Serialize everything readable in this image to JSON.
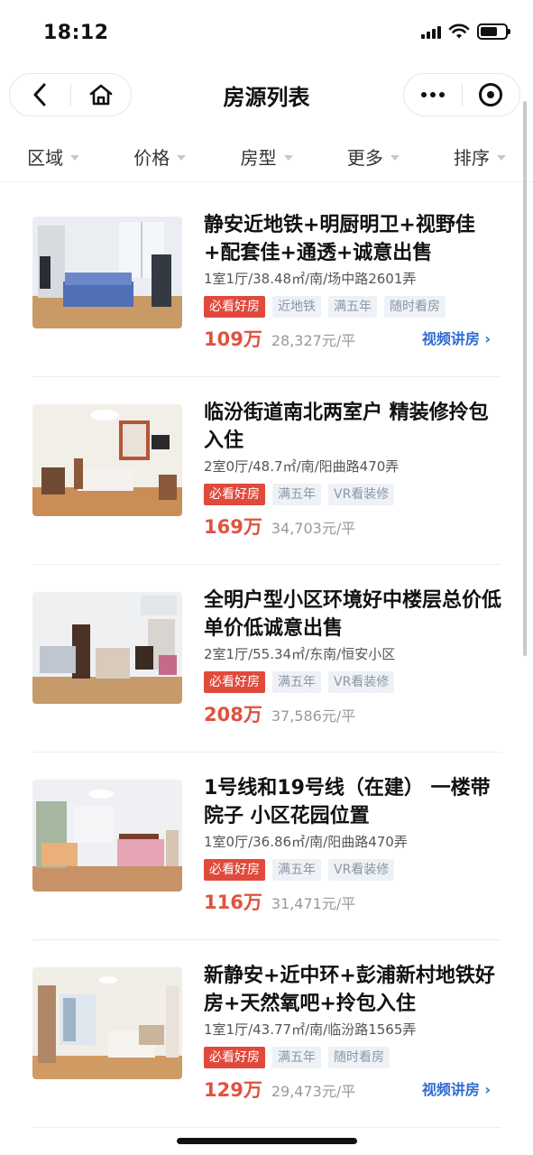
{
  "status": {
    "time": "18:12",
    "icons": [
      "signal-icon",
      "wifi-icon",
      "battery-icon"
    ]
  },
  "nav": {
    "title": "房源列表",
    "back_icon": "back-chevron-icon",
    "home_icon": "home-icon",
    "more_icon": "more-dots-icon",
    "close_icon": "target-icon"
  },
  "filters": [
    {
      "label": "区域"
    },
    {
      "label": "价格"
    },
    {
      "label": "房型"
    },
    {
      "label": "更多"
    },
    {
      "label": "排序"
    }
  ],
  "listings": [
    {
      "title": "静安近地铁+明厨明卫+视野佳+配套佳+通透+诚意出售",
      "meta": "1室1厅/38.48㎡/南/场中路2601弄",
      "tags": [
        "必看好房",
        "近地铁",
        "满五年",
        "随时看房"
      ],
      "price": "109万",
      "unit_price": "28,327元/平",
      "video": "视频讲房 ›"
    },
    {
      "title": "临汾街道南北两室户 精装修拎包入住",
      "meta": "2室0厅/48.7㎡/南/阳曲路470弄",
      "tags": [
        "必看好房",
        "满五年",
        "VR看装修"
      ],
      "price": "169万",
      "unit_price": "34,703元/平",
      "video": ""
    },
    {
      "title": "全明户型小区环境好中楼层总价低单价低诚意出售",
      "meta": "2室1厅/55.34㎡/东南/恒安小区",
      "tags": [
        "必看好房",
        "满五年",
        "VR看装修"
      ],
      "price": "208万",
      "unit_price": "37,586元/平",
      "video": ""
    },
    {
      "title": "1号线和19号线（在建） 一楼带院子 小区花园位置",
      "meta": "1室0厅/36.86㎡/南/阳曲路470弄",
      "tags": [
        "必看好房",
        "满五年",
        "VR看装修"
      ],
      "price": "116万",
      "unit_price": "31,471元/平",
      "video": ""
    },
    {
      "title": "新静安+近中环+彭浦新村地铁好房+天然氧吧+拎包入住",
      "meta": "1室1厅/43.77㎡/南/临汾路1565弄",
      "tags": [
        "必看好房",
        "满五年",
        "随时看房"
      ],
      "price": "129万",
      "unit_price": "29,473元/平",
      "video": "视频讲房 ›"
    }
  ],
  "colors": {
    "accent_price": "#e0523f",
    "hot_tag": "#e04a3c",
    "link": "#2f6bd1"
  }
}
